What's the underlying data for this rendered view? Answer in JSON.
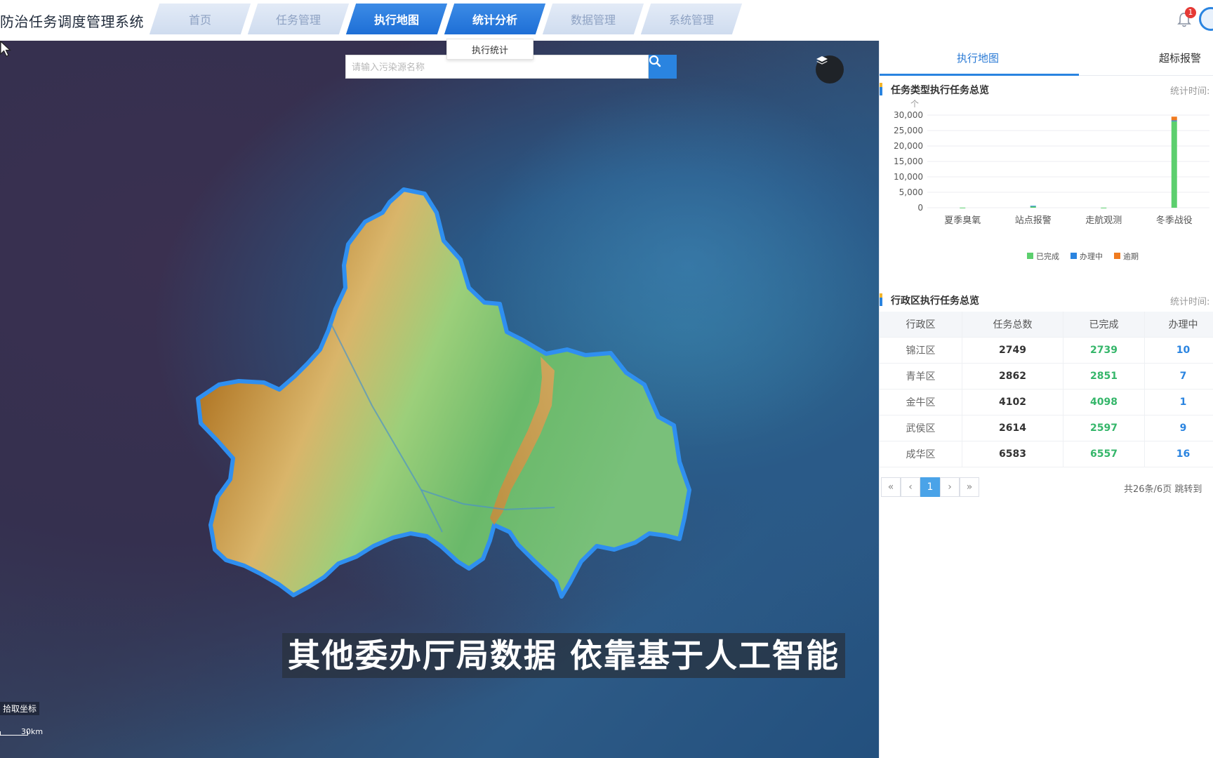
{
  "app": {
    "title": "防治任务调度管理系统"
  },
  "nav": {
    "tabs": [
      {
        "label": "首页"
      },
      {
        "label": "任务管理"
      },
      {
        "label": "执行地图"
      },
      {
        "label": "统计分析"
      },
      {
        "label": "数据管理"
      },
      {
        "label": "系统管理"
      }
    ],
    "active": [
      "执行地图",
      "统计分析"
    ],
    "dropdown_item": "执行统计"
  },
  "header": {
    "notification_count": "1"
  },
  "map": {
    "search_placeholder": "请输入污染源名称",
    "coord_label": "拾取坐标",
    "scale_label": "30km",
    "subtitle": "其他委办厅局数据 依靠基于人工智能"
  },
  "panel": {
    "tabs": [
      {
        "label": "执行地图",
        "active": true
      },
      {
        "label": "超标报警",
        "active": false
      }
    ],
    "task_type_section": {
      "title": "任务类型执行任务总览",
      "time_label": "统计时间:"
    },
    "district_section": {
      "title": "行政区执行任务总览",
      "time_label": "统计时间:"
    }
  },
  "chart_data": {
    "type": "bar",
    "stacked": true,
    "ylabel": "个",
    "ylim": [
      0,
      30000
    ],
    "yticks": [
      "30,000",
      "25,000",
      "20,000",
      "15,000",
      "10,000",
      "5,000",
      "0"
    ],
    "categories": [
      "夏季臭氧",
      "站点报警",
      "走航观测",
      "冬季战役"
    ],
    "series": [
      {
        "name": "已完成",
        "color": "#5ccf6e",
        "values": [
          50,
          600,
          40,
          28000
        ]
      },
      {
        "name": "办理中",
        "color": "#2a84e0",
        "values": [
          0,
          20,
          0,
          300
        ]
      },
      {
        "name": "逾期",
        "color": "#f07b20",
        "values": [
          0,
          0,
          0,
          1200
        ]
      }
    ],
    "legend_position": "bottom",
    "grid": true
  },
  "district_table": {
    "headers": [
      "行政区",
      "任务总数",
      "已完成",
      "办理中"
    ],
    "rows": [
      {
        "district": "锦江区",
        "total": "2749",
        "done": "2739",
        "doing": "10"
      },
      {
        "district": "青羊区",
        "total": "2862",
        "done": "2851",
        "doing": "7"
      },
      {
        "district": "金牛区",
        "total": "4102",
        "done": "4098",
        "doing": "1"
      },
      {
        "district": "武侯区",
        "total": "2614",
        "done": "2597",
        "doing": "9"
      },
      {
        "district": "成华区",
        "total": "6583",
        "done": "6557",
        "doing": "16"
      }
    ]
  },
  "pager": {
    "first": "«",
    "prev": "‹",
    "current": "1",
    "next": "›",
    "last": "»",
    "info": "共26条/6页 跳转到"
  },
  "icons": {
    "search": "search-icon",
    "layers": "layers-icon",
    "bell": "bell-icon",
    "avatar": "avatar-icon"
  }
}
